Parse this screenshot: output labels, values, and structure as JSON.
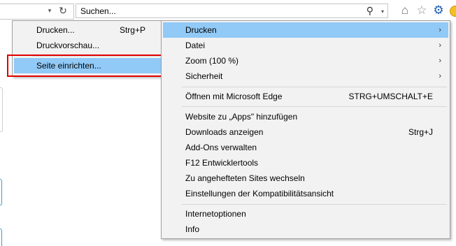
{
  "toolbar": {
    "address_dropdown_glyph": "▾",
    "refresh_glyph": "↻",
    "search_placeholder": "Suchen...",
    "search_glyph": "⚲",
    "search_dropdown_glyph": "▾",
    "home_glyph": "⌂",
    "favorites_glyph": "☆",
    "tools_glyph": "⚙"
  },
  "submenu": {
    "items": [
      {
        "label": "Drucken...",
        "shortcut": "Strg+P"
      },
      {
        "label": "Druckvorschau...",
        "shortcut": ""
      },
      {
        "label": "Seite einrichten...",
        "shortcut": "",
        "highlighted": true
      }
    ]
  },
  "menu": {
    "items": [
      {
        "label": "Drucken",
        "submenu": true,
        "highlighted": true
      },
      {
        "label": "Datei",
        "submenu": true
      },
      {
        "label": "Zoom (100 %)",
        "submenu": true
      },
      {
        "label": "Sicherheit",
        "submenu": true
      },
      {
        "label": "Öffnen mit Microsoft Edge",
        "shortcut": "STRG+UMSCHALT+E"
      },
      {
        "label": "Website zu „Apps\" hinzufügen"
      },
      {
        "label": "Downloads anzeigen",
        "shortcut": "Strg+J"
      },
      {
        "label": "Add-Ons verwalten"
      },
      {
        "label": "F12 Entwicklertools"
      },
      {
        "label": "Zu angehefteten Sites wechseln"
      },
      {
        "label": "Einstellungen der Kompatibilitätsansicht"
      },
      {
        "label": "Internetoptionen"
      },
      {
        "label": "Info"
      }
    ],
    "submenu_arrow": "›"
  },
  "colors": {
    "highlight": "#91c9f7",
    "menu_bg": "#f2f2f2",
    "annotation_box": "#e00000"
  }
}
